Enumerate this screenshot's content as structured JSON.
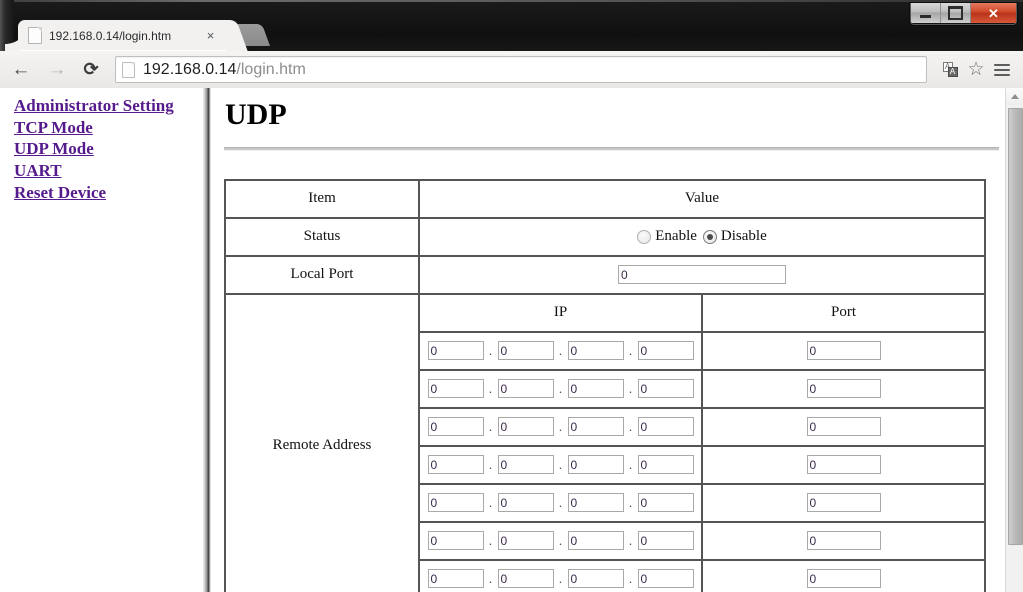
{
  "browser": {
    "tab": {
      "title": "192.168.0.14/login.htm",
      "favicon": "page-icon",
      "close_label": "×"
    },
    "window_controls": {
      "minimize": "minimize-icon",
      "maximize": "maximize-icon",
      "close": "✕"
    },
    "toolbar": {
      "back": "←",
      "forward": "→",
      "reload": "⟳",
      "url_host": "192.168.0.14",
      "url_path": "/login.htm",
      "url_full": "192.168.0.14/login.htm",
      "translate_icon": "translate-icon",
      "translate_a": "A",
      "translate_b": "A",
      "bookmark_star": "☆",
      "menu": "hamburger-menu-icon"
    }
  },
  "sidebar": {
    "items": [
      {
        "label": "Administrator Setting"
      },
      {
        "label": "TCP Mode"
      },
      {
        "label": "UDP Mode"
      },
      {
        "label": "UART"
      },
      {
        "label": "Reset Device"
      }
    ]
  },
  "content": {
    "heading": "UDP",
    "table": {
      "headers": {
        "item": "Item",
        "value": "Value"
      },
      "status": {
        "label": "Status",
        "options": [
          {
            "label": "Enable",
            "checked": false
          },
          {
            "label": "Disable",
            "checked": true
          }
        ]
      },
      "local_port": {
        "label": "Local Port",
        "value": "0"
      },
      "remote_address": {
        "label": "Remote Address",
        "subheaders": {
          "ip": "IP",
          "port": "Port"
        },
        "separator": ".",
        "rows": [
          {
            "octets": [
              "0",
              "0",
              "0",
              "0"
            ],
            "port": "0"
          },
          {
            "octets": [
              "0",
              "0",
              "0",
              "0"
            ],
            "port": "0"
          },
          {
            "octets": [
              "0",
              "0",
              "0",
              "0"
            ],
            "port": "0"
          },
          {
            "octets": [
              "0",
              "0",
              "0",
              "0"
            ],
            "port": "0"
          },
          {
            "octets": [
              "0",
              "0",
              "0",
              "0"
            ],
            "port": "0"
          },
          {
            "octets": [
              "0",
              "0",
              "0",
              "0"
            ],
            "port": "0"
          },
          {
            "octets": [
              "0",
              "0",
              "0",
              "0"
            ],
            "port": "0"
          }
        ]
      }
    }
  },
  "scrollbar": {
    "up_arrow": "scroll-up-arrow"
  }
}
